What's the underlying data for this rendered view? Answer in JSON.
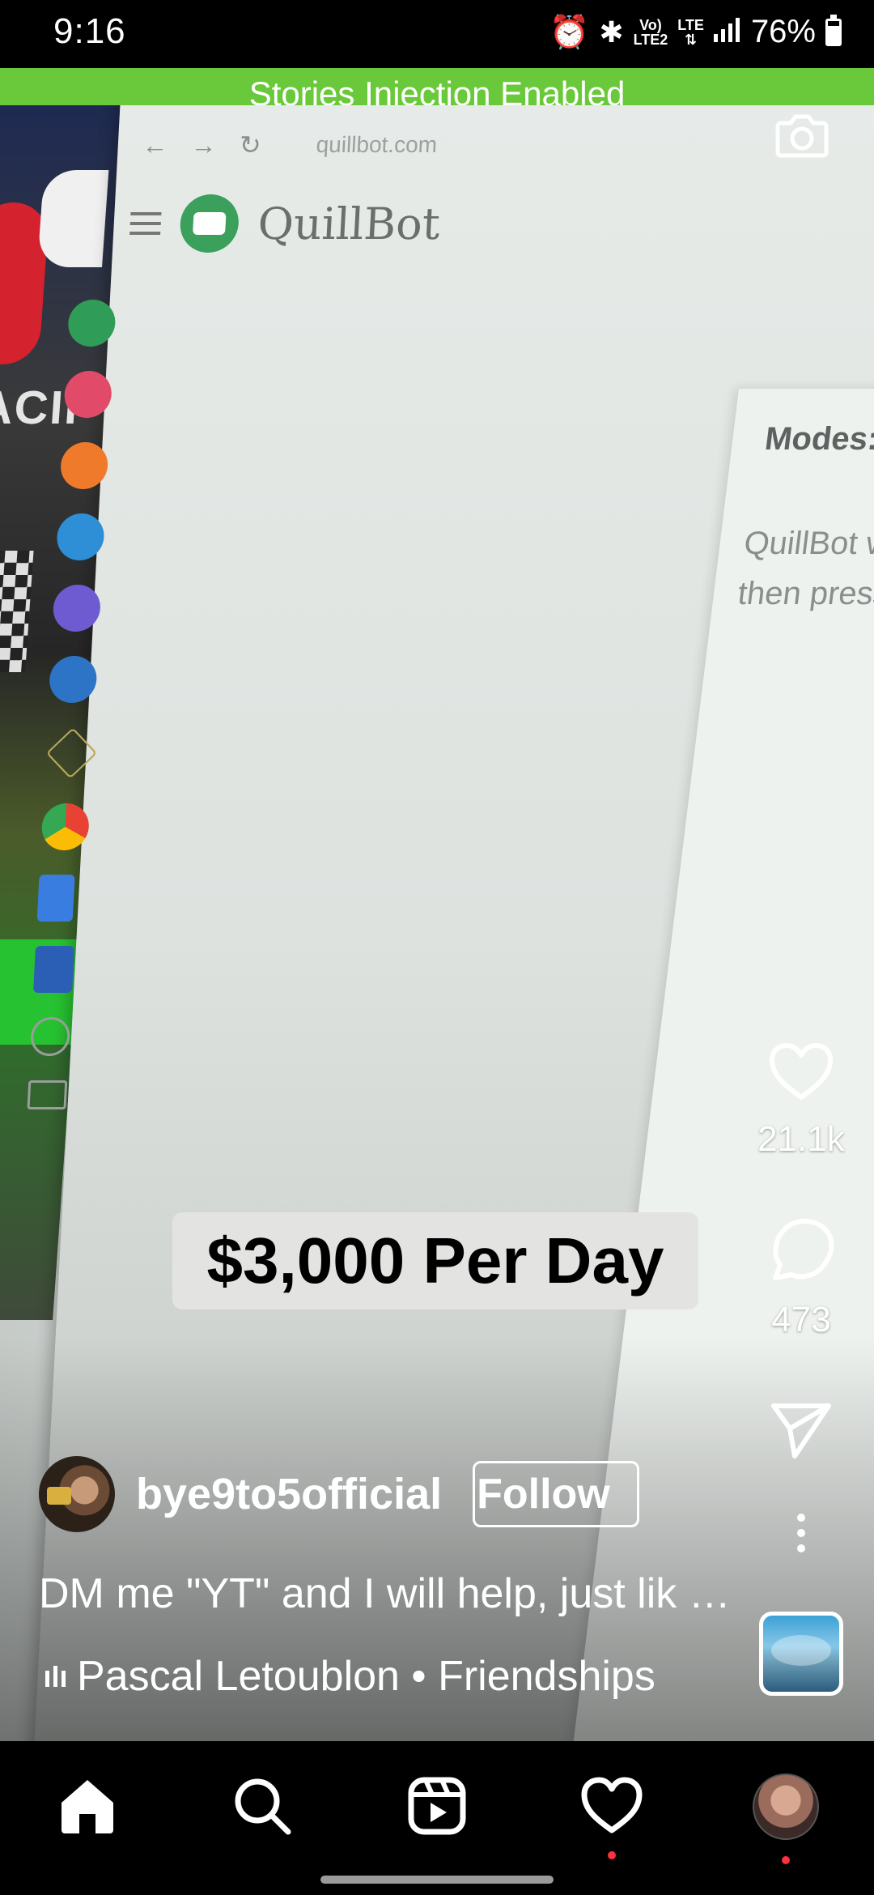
{
  "status_bar": {
    "time": "9:16",
    "network_top": "Vo)",
    "network_bottom": "LTE2",
    "lte_label": "LTE",
    "battery": "76%"
  },
  "banner": {
    "text": "Stories Injection Enabled"
  },
  "video": {
    "browser_url": "quillbot.com",
    "brand_name": "QuillBot",
    "left_partial_text": "ACII",
    "modes_label": "Modes:",
    "modes_text_line1": "QuillBot will",
    "modes_text_line2": "then press th",
    "overlay_caption": "$3,000 Per Day"
  },
  "actions": {
    "likes": "21.1k",
    "comments": "473"
  },
  "post": {
    "username": "bye9to5official",
    "follow_label": "Follow",
    "caption": "DM me \"YT\" and I will help, just lik …",
    "audio": "Pascal Letoublon • Friendships"
  },
  "colors": {
    "banner_green": "#6ac93a",
    "notification_red": "#ff3040",
    "caption_box": "#e3e3e1"
  },
  "icons": {
    "camera": "camera-icon",
    "like": "heart-icon",
    "comment": "comment-bubble-icon",
    "share": "paper-plane-icon",
    "more": "more-vertical-icon",
    "nav": [
      "home-icon",
      "search-icon",
      "reels-icon",
      "heart-icon",
      "profile-avatar"
    ]
  }
}
